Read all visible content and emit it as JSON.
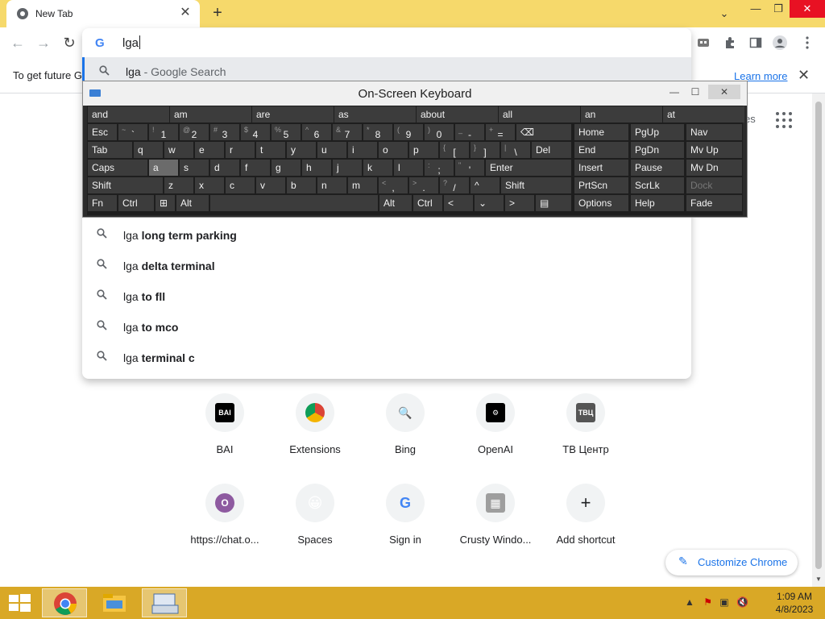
{
  "tab": {
    "title": "New Tab",
    "close": "✕"
  },
  "newtab": "+",
  "window": {
    "tabsearch": "⌄",
    "min": "—",
    "max": "❐",
    "close": "✕"
  },
  "toolbar": {
    "back": "←",
    "forward": "→",
    "reload": "↻"
  },
  "infobar": {
    "message": "To get future G",
    "learn_more": "Learn more",
    "close": "✕"
  },
  "omnibox": {
    "google": "G",
    "query": "lga"
  },
  "suggestions": [
    {
      "prefix": "lga",
      "rest": " - Google Search"
    },
    {
      "prefix": "lga ",
      "bold": "long term parking"
    },
    {
      "prefix": "lga ",
      "bold": "delta terminal"
    },
    {
      "prefix": "lga ",
      "bold": "to fll"
    },
    {
      "prefix": "lga ",
      "bold": "to mco"
    },
    {
      "prefix": "lga ",
      "bold": "terminal c"
    }
  ],
  "ntp_partial": "es",
  "osk": {
    "title": "On-Screen Keyboard",
    "min": "—",
    "max": "☐",
    "close": "✕",
    "predictions": [
      "and",
      "am",
      "are",
      "as",
      "about",
      "all",
      "an",
      "at"
    ],
    "row1": [
      {
        "label": "Esc"
      },
      {
        "sub": "~",
        "main": "`"
      },
      {
        "sub": "!",
        "main": "1"
      },
      {
        "sub": "@",
        "main": "2"
      },
      {
        "sub": "#",
        "main": "3"
      },
      {
        "sub": "$",
        "main": "4"
      },
      {
        "sub": "%",
        "main": "5"
      },
      {
        "sub": "^",
        "main": "6"
      },
      {
        "sub": "&",
        "main": "7"
      },
      {
        "sub": "*",
        "main": "8"
      },
      {
        "sub": "(",
        "main": "9"
      },
      {
        "sub": ")",
        "main": "0"
      },
      {
        "sub": "_",
        "main": "-"
      },
      {
        "sub": "+",
        "main": "="
      },
      {
        "label": "⌫"
      }
    ],
    "row2": [
      {
        "label": "Tab"
      },
      {
        "label": "q"
      },
      {
        "label": "w"
      },
      {
        "label": "e"
      },
      {
        "label": "r"
      },
      {
        "label": "t"
      },
      {
        "label": "y"
      },
      {
        "label": "u"
      },
      {
        "label": "i"
      },
      {
        "label": "o"
      },
      {
        "label": "p"
      },
      {
        "sub": "{",
        "main": "["
      },
      {
        "sub": "}",
        "main": "]"
      },
      {
        "sub": "|",
        "main": "\\"
      },
      {
        "label": "Del"
      }
    ],
    "row3": [
      {
        "label": "Caps"
      },
      {
        "label": "a"
      },
      {
        "label": "s"
      },
      {
        "label": "d"
      },
      {
        "label": "f"
      },
      {
        "label": "g"
      },
      {
        "label": "h"
      },
      {
        "label": "j"
      },
      {
        "label": "k"
      },
      {
        "label": "l"
      },
      {
        "sub": ":",
        "main": ";"
      },
      {
        "sub": "\"",
        "main": "'"
      },
      {
        "label": "Enter"
      }
    ],
    "row4": [
      {
        "label": "Shift"
      },
      {
        "label": "z"
      },
      {
        "label": "x"
      },
      {
        "label": "c"
      },
      {
        "label": "v"
      },
      {
        "label": "b"
      },
      {
        "label": "n"
      },
      {
        "label": "m"
      },
      {
        "sub": "<",
        "main": ","
      },
      {
        "sub": ">",
        "main": "."
      },
      {
        "sub": "?",
        "main": "/"
      },
      {
        "label": "^"
      },
      {
        "label": "Shift"
      }
    ],
    "row5": [
      {
        "label": "Fn"
      },
      {
        "label": "Ctrl"
      },
      {
        "label": "⊞"
      },
      {
        "label": "Alt"
      },
      {
        "label": ""
      },
      {
        "label": "Alt"
      },
      {
        "label": "Ctrl"
      },
      {
        "label": "<"
      },
      {
        "label": "⌄"
      },
      {
        "label": ">"
      },
      {
        "label": "▤"
      }
    ],
    "nav": [
      [
        "Home",
        "PgUp",
        "Nav"
      ],
      [
        "End",
        "PgDn",
        "Mv Up"
      ],
      [
        "Insert",
        "Pause",
        "Mv Dn"
      ],
      [
        "PrtScn",
        "ScrLk",
        "Dock"
      ],
      [
        "Options",
        "Help",
        "Fade"
      ]
    ]
  },
  "shortcuts": [
    {
      "label": "BAI",
      "icon": "BAI",
      "color": "#000000"
    },
    {
      "label": "Extensions",
      "icon": "",
      "color": "#4285f4"
    },
    {
      "label": "Bing",
      "icon": "🔍",
      "color": "#e8f0fe"
    },
    {
      "label": "OpenAI",
      "icon": "⚙",
      "color": "#000000"
    },
    {
      "label": "ТВ Центр",
      "icon": "ТВЦ",
      "color": "#555555"
    },
    {
      "label": "https://chat.o...",
      "icon": "O",
      "color": "#8e5aa0"
    },
    {
      "label": "Spaces",
      "icon": "😀",
      "color": "#ffd21e"
    },
    {
      "label": "Sign in",
      "icon": "G",
      "color": "#ffffff"
    },
    {
      "label": "Crusty Windo...",
      "icon": "▦",
      "color": "#9e9e9e"
    },
    {
      "label": "Add shortcut",
      "icon": "+",
      "color": "#f1f3f4"
    }
  ],
  "customize": {
    "icon": "✎",
    "label": "Customize Chrome"
  },
  "taskbar": {
    "time": "1:09 AM",
    "date": "4/8/2023"
  }
}
